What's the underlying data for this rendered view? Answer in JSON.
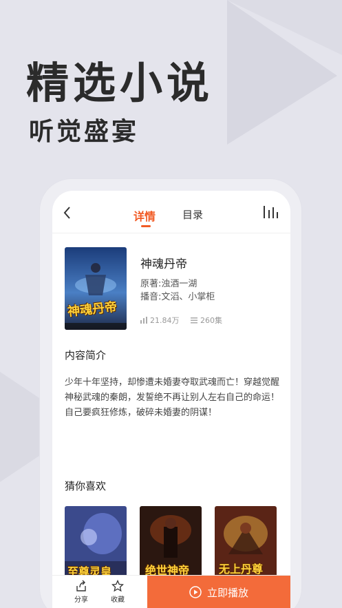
{
  "promo": {
    "headline": "精选小说",
    "subhead": "听觉盛宴"
  },
  "header": {
    "tabs": [
      {
        "label": "详情",
        "active": true
      },
      {
        "label": "目录",
        "active": false
      }
    ],
    "back_icon": "chevron-left-icon",
    "menu_icon": "equalizer-icon"
  },
  "book": {
    "title": "神魂丹帝",
    "cover_text": "神魂丹帝",
    "author": "原著:浊酒一湖",
    "narrator": "播音:文滔、小掌柜",
    "plays": "21.84万",
    "episodes": "260集"
  },
  "intro": {
    "title": "内容简介",
    "text": "少年十年坚持，却惨遭未婚妻夺取武魂而亡！穿越觉醒神秘武魂的秦朗，发誓绝不再让别人左右自己的命运！自己要疯狂修炼，破碎未婚妻的阴谋！"
  },
  "recommend": {
    "title": "猜你喜欢",
    "items": [
      {
        "cover_text": "至尊灵皇"
      },
      {
        "cover_text": "绝世神帝"
      },
      {
        "cover_text": "无上丹尊"
      }
    ]
  },
  "bottom_bar": {
    "share_label": "分享",
    "favorite_label": "收藏",
    "play_label": "立即播放"
  },
  "colors": {
    "accent": "#f15a24",
    "play_button": "#f36b3a",
    "background": "#e4e4ec"
  }
}
